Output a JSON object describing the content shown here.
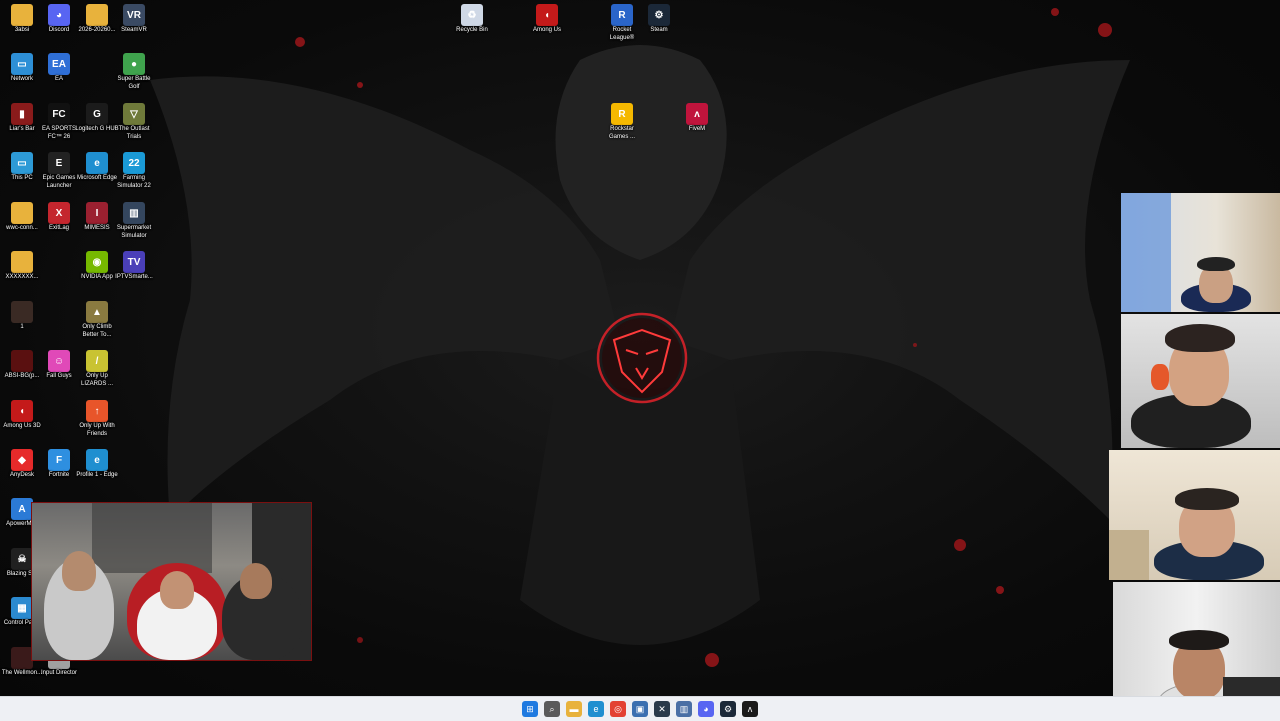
{
  "desktop": {
    "icons_left": [
      {
        "label": "3absi",
        "color": "#e8b23c",
        "glyph": ""
      },
      {
        "label": "Discord",
        "color": "#5865f2",
        "glyph": "◕"
      },
      {
        "label": "2026-20260...",
        "color": "#e8b23c",
        "glyph": ""
      },
      {
        "label": "SteamVR",
        "color": "#3a4a63",
        "glyph": "VR"
      },
      {
        "label": "Network",
        "color": "#2d8fd6",
        "glyph": "▭"
      },
      {
        "label": "EA",
        "color": "#2f6fd6",
        "glyph": "EA"
      },
      {
        "label": "Super Battle Golf",
        "color": "#3fa34d",
        "glyph": "●"
      },
      {
        "label": "Liar's Bar",
        "color": "#8a1b1b",
        "glyph": "▮"
      },
      {
        "label": "EA SPORTS FC™ 26",
        "color": "#111111",
        "glyph": "FC"
      },
      {
        "label": "Logitech G HUB",
        "color": "#1b1b1b",
        "glyph": "G"
      },
      {
        "label": "The Outlast Trials",
        "color": "#6f7a3a",
        "glyph": "▽"
      },
      {
        "label": "This PC",
        "color": "#2d9ad6",
        "glyph": "▭"
      },
      {
        "label": "Epic Games Launcher",
        "color": "#222222",
        "glyph": "E"
      },
      {
        "label": "Microsoft Edge",
        "color": "#1f8fd0",
        "glyph": "e"
      },
      {
        "label": "Farming Simulator 22",
        "color": "#1a9ad6",
        "glyph": "22"
      },
      {
        "label": "wwc-conn...",
        "color": "#e8b23c",
        "glyph": ""
      },
      {
        "label": "ExitLag",
        "color": "#c4262e",
        "glyph": "X"
      },
      {
        "label": "MIMESIS",
        "color": "#9b2030",
        "glyph": "I"
      },
      {
        "label": "Supermarket Simulator",
        "color": "#34465e",
        "glyph": "▥"
      },
      {
        "label": "XXXXXXX...",
        "color": "#e8b23c",
        "glyph": ""
      },
      {
        "label": "NVIDIA App",
        "color": "#76b900",
        "glyph": "◉"
      },
      {
        "label": "IPTVSmarte...",
        "color": "#4a3fb8",
        "glyph": "TV"
      },
      {
        "label": "1",
        "color": "#3a2a24",
        "glyph": ""
      },
      {
        "label": "Only Climb Better To...",
        "color": "#8a7a40",
        "glyph": "▲"
      },
      {
        "label": "ABSI-BG(p...",
        "color": "#5a1010",
        "glyph": ""
      },
      {
        "label": "Fall Guys",
        "color": "#e049b8",
        "glyph": "☺"
      },
      {
        "label": "Only Up LIZARDS ...",
        "color": "#c9c332",
        "glyph": "/"
      },
      {
        "label": "Among Us 3D",
        "color": "#c41a1a",
        "glyph": "◖"
      },
      {
        "label": "Only Up With Friends",
        "color": "#e8552a",
        "glyph": "↑"
      },
      {
        "label": "AnyDesk",
        "color": "#e62a2a",
        "glyph": "◆"
      },
      {
        "label": "Fortnite",
        "color": "#2e8fe0",
        "glyph": "F"
      },
      {
        "label": "Profile 1 - Edge",
        "color": "#1f8fd0",
        "glyph": "e"
      },
      {
        "label": "ApowerMi...",
        "color": "#2b7ad6",
        "glyph": "A"
      },
      {
        "label": "Blazing S...",
        "color": "#202020",
        "glyph": "☠"
      },
      {
        "label": "Control Panel",
        "color": "#2b8ad0",
        "glyph": "▦"
      },
      {
        "label": "The Wellmon...",
        "color": "#3a1a1a",
        "glyph": ""
      },
      {
        "label": "Input Director",
        "color": "#a0a0a0",
        "glyph": "▭"
      }
    ],
    "icons_top": [
      {
        "label": "Recycle Bin",
        "color": "#cfd8e6",
        "glyph": "♻"
      },
      {
        "label": "Among Us",
        "color": "#c41a1a",
        "glyph": "◖"
      },
      {
        "label": "Rocket League®",
        "color": "#2a65c9",
        "glyph": "R"
      },
      {
        "label": "Steam",
        "color": "#1b2838",
        "glyph": "⚙"
      },
      {
        "label": "Rockstar Games ...",
        "color": "#f5b800",
        "glyph": "R"
      },
      {
        "label": "FiveM",
        "color": "#c0143c",
        "glyph": "ʌ"
      }
    ]
  },
  "taskbar": {
    "items": [
      {
        "name": "start",
        "color": "#1f7ae0",
        "glyph": "⊞"
      },
      {
        "name": "search",
        "color": "#5a5a5a",
        "glyph": "⌕"
      },
      {
        "name": "file-explorer",
        "color": "#e8b23c",
        "glyph": "▬"
      },
      {
        "name": "edge",
        "color": "#1f8fd0",
        "glyph": "e"
      },
      {
        "name": "chrome",
        "color": "#e34133",
        "glyph": "◎"
      },
      {
        "name": "app-a",
        "color": "#3b6fb0",
        "glyph": "▣"
      },
      {
        "name": "app-b",
        "color": "#2a3a4a",
        "glyph": "✕"
      },
      {
        "name": "app-c",
        "color": "#4a6fa5",
        "glyph": "▥"
      },
      {
        "name": "discord",
        "color": "#5865f2",
        "glyph": "◕"
      },
      {
        "name": "steam",
        "color": "#1b2838",
        "glyph": "⚙"
      },
      {
        "name": "fivem",
        "color": "#1a1a1a",
        "glyph": "ʌ"
      }
    ]
  }
}
